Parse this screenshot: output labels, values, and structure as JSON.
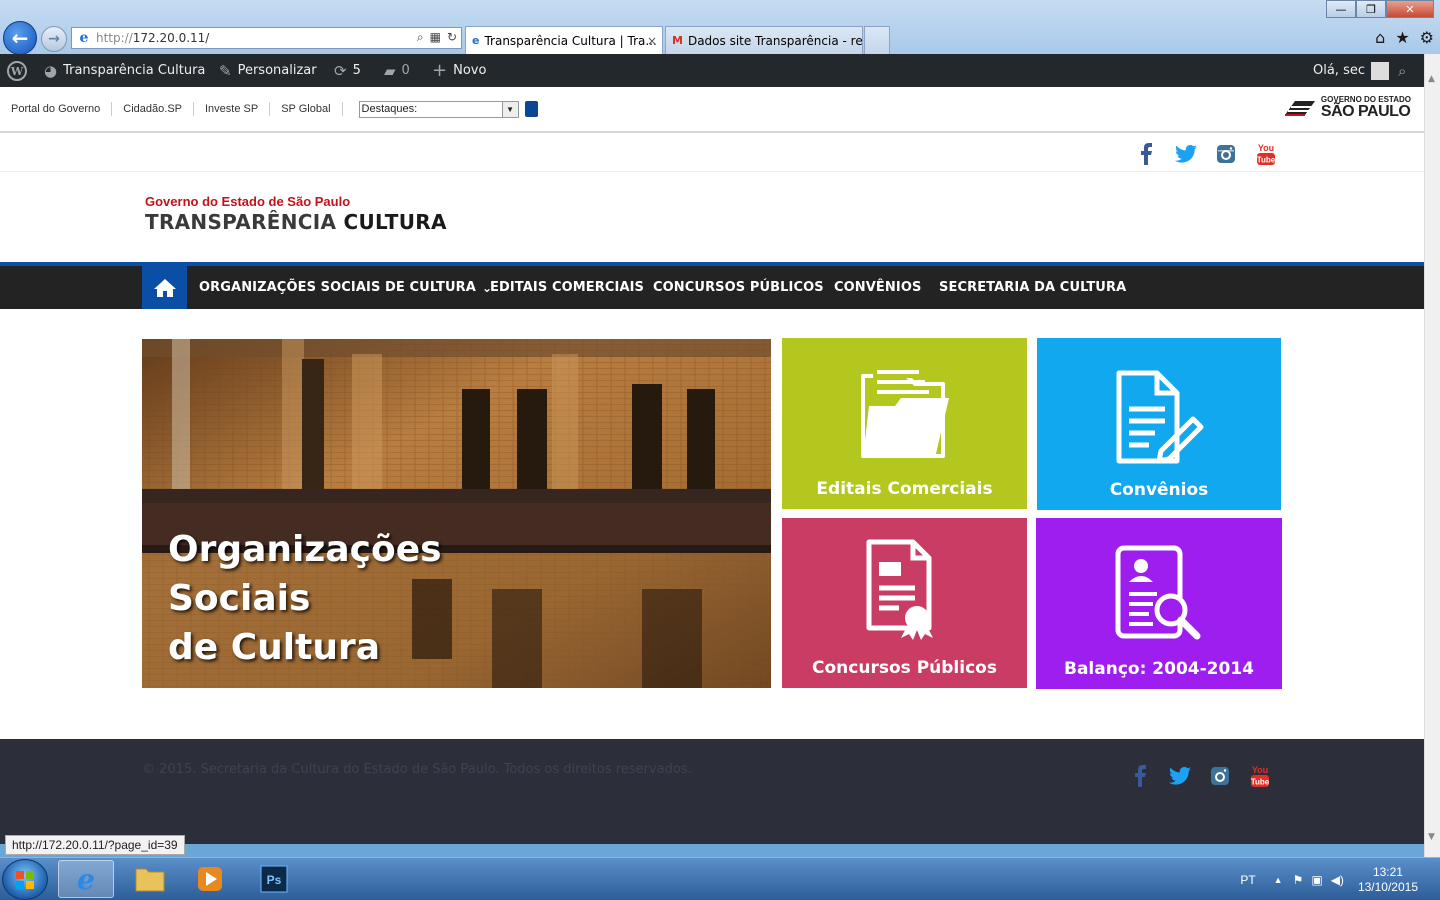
{
  "browser": {
    "address_protocol": "http://",
    "address_host": "172.20.0.11/",
    "tabs": [
      {
        "label": "Transparência Cultura | Tra...",
        "close": "×"
      },
      {
        "label": "Dados site Transparência - ren..."
      }
    ]
  },
  "wp_admin_bar": {
    "site_name": "Transparência Cultura",
    "customize": "Personalizar",
    "updates_count": "5",
    "comments_count": "0",
    "new": "Novo",
    "greeting": "Olá, sec"
  },
  "gov_bar": {
    "links": [
      "Portal do Governo",
      "Cidadão.SP",
      "Investe SP",
      "SP Global"
    ],
    "select_value": "Destaques:",
    "logo_line1": "GOVERNO DO ESTADO",
    "logo_line2": "SÃO PAULO"
  },
  "brand": {
    "subtitle": "Governo do Estado de São Paulo",
    "title_light": "TRANSPARÊNCIA ",
    "title_bold": "CULTURA"
  },
  "nav": {
    "items": [
      "ORGANIZAÇÕES SOCIAIS DE CULTURA",
      "EDITAIS COMERCIAIS",
      "CONCURSOS PÚBLICOS",
      "CONVÊNIOS",
      "SECRETARIA DA CULTURA"
    ],
    "dropdown_caret": "⌄"
  },
  "hero": {
    "title": "Organizações\nSociais\nde Cultura"
  },
  "tiles": [
    {
      "label": "Editais Comerciais",
      "color": "#b3c71e",
      "icon": "folder-icon"
    },
    {
      "label": "Convênios",
      "color": "#12a8f0",
      "icon": "document-edit-icon"
    },
    {
      "label": "Concursos Públicos",
      "color": "#c93c64",
      "icon": "certificate-icon"
    },
    {
      "label": "Balanço: 2004-2014",
      "color": "#9e1ef0",
      "icon": "profile-search-icon"
    }
  ],
  "footer": {
    "copyright": "© 2015. Secretaria da Cultura do Estado de São Paulo. Todos os direitos reservados."
  },
  "status_url": "http://172.20.0.11/?page_id=39",
  "taskbar": {
    "lang": "PT",
    "time": "13:21",
    "date": "13/10/2015"
  },
  "colors": {
    "nav_accent": "#0b4ea6",
    "brand_red": "#c0131a",
    "facebook": "#3b5998",
    "twitter": "#1da1f2",
    "youtube": "#e52d27"
  }
}
